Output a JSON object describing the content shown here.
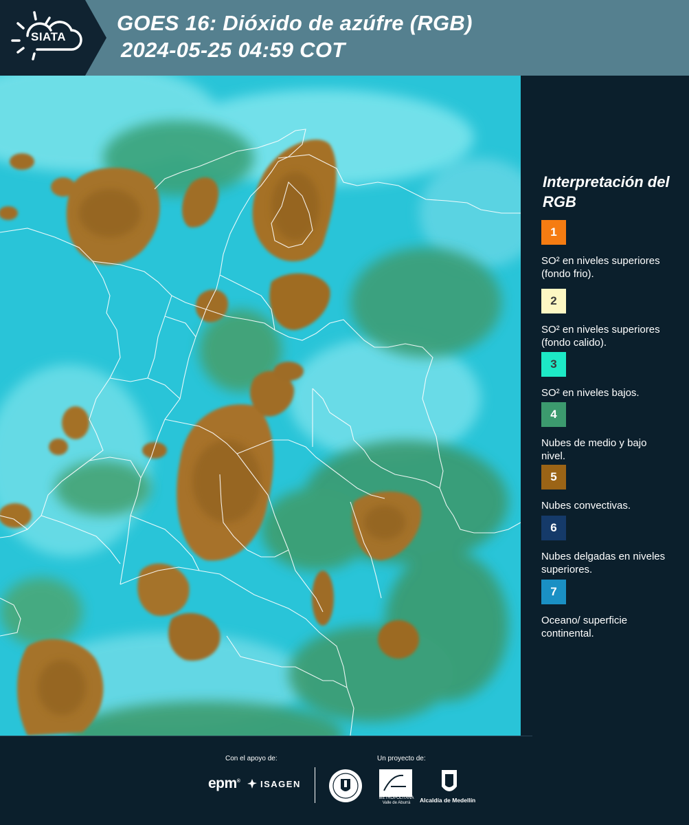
{
  "header": {
    "logo_text": "SIATA",
    "title_line1": "GOES 16: Dióxido de azúfre (RGB)",
    "title_line2": "2024-05-25 04:59 COT"
  },
  "legend": {
    "title": "Interpretación del RGB",
    "items": [
      {
        "number": "1",
        "label": "SO² en niveles superiores (fondo frio).",
        "color": "#f57c12",
        "number_color": "#ffffff"
      },
      {
        "number": "2",
        "label": "SO² en niveles superiores (fondo calido).",
        "color": "#fdf7c3",
        "number_color": "#3a3a3a"
      },
      {
        "number": "3",
        "label": "SO² en niveles bajos.",
        "color": "#1de9c6",
        "number_color": "#3a3a3a"
      },
      {
        "number": "4",
        "label": "Nubes de medio y bajo nivel.",
        "color": "#3c9a6e",
        "number_color": "#ffffff"
      },
      {
        "number": "5",
        "label": "Nubes convectivas.",
        "color": "#9b6416",
        "number_color": "#ffffff"
      },
      {
        "number": "6",
        "label": "Nubes delgadas en niveles superiores.",
        "color": "#153a69",
        "number_color": "#ffffff"
      },
      {
        "number": "7",
        "label": "Oceano/ superficie continental.",
        "color": "#1a90c4",
        "number_color": "#ffffff"
      }
    ]
  },
  "footer": {
    "support_label": "Con el apoyo de:",
    "project_label": "Un proyecto de:",
    "sponsor_1": "epm",
    "sponsor_2": "ISAGEN",
    "partner_1": "METROPOLITANA Valle de Aburrá",
    "partner_2": "Alcaldía de Medellín"
  }
}
